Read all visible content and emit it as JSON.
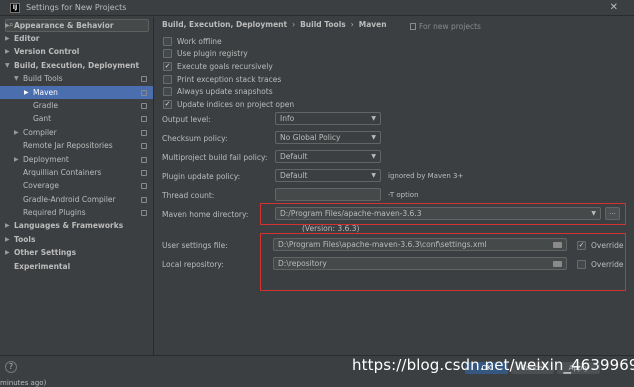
{
  "window": {
    "title": "Settings for New Projects",
    "logo": "IJ"
  },
  "search": {
    "placeholder": ""
  },
  "sidebar": {
    "items": [
      {
        "label": "Appearance & Behavior",
        "arrow": "▶",
        "bold": true
      },
      {
        "label": "Editor",
        "arrow": "▶",
        "bold": true
      },
      {
        "label": "Version Control",
        "arrow": "▶",
        "bold": true
      },
      {
        "label": "Build, Execution, Deployment",
        "arrow": "▼",
        "bold": true
      },
      {
        "label": "Build Tools",
        "arrow": "▼"
      },
      {
        "label": "Maven",
        "arrow": "▶",
        "selected": true
      },
      {
        "label": "Gradle",
        "arrow": ""
      },
      {
        "label": "Gant",
        "arrow": ""
      },
      {
        "label": "Compiler",
        "arrow": "▶"
      },
      {
        "label": "Remote Jar Repositories",
        "arrow": ""
      },
      {
        "label": "Deployment",
        "arrow": "▶"
      },
      {
        "label": "Arquillian Containers",
        "arrow": ""
      },
      {
        "label": "Coverage",
        "arrow": ""
      },
      {
        "label": "Gradle-Android Compiler",
        "arrow": ""
      },
      {
        "label": "Required Plugins",
        "arrow": ""
      },
      {
        "label": "Languages & Frameworks",
        "arrow": "▶",
        "bold": true
      },
      {
        "label": "Tools",
        "arrow": "▶",
        "bold": true
      },
      {
        "label": "Other Settings",
        "arrow": "▶",
        "bold": true
      },
      {
        "label": "Experimental",
        "arrow": "",
        "bold": true
      }
    ]
  },
  "breadcrumb": {
    "part1": "Build, Execution, Deployment",
    "part2": "Build Tools",
    "part3": "Maven",
    "sep": "›"
  },
  "for_new_projects": "For new projects",
  "checkboxes": [
    {
      "label": "Work offline",
      "checked": false
    },
    {
      "label": "Use plugin registry",
      "checked": false
    },
    {
      "label": "Execute goals recursively",
      "checked": true
    },
    {
      "label": "Print exception stack traces",
      "checked": false
    },
    {
      "label": "Always update snapshots",
      "checked": false
    },
    {
      "label": "Update indices on project open",
      "checked": true
    }
  ],
  "check_glyph": "✓",
  "fields": {
    "output_level": {
      "label": "Output level:",
      "value": "Info"
    },
    "checksum_policy": {
      "label": "Checksum policy:",
      "value": "No Global Policy"
    },
    "multiproject_fail": {
      "label": "Multiproject build fail policy:",
      "value": "Default"
    },
    "plugin_update": {
      "label": "Plugin update policy:",
      "value": "Default",
      "note": "ignored by Maven 3+"
    },
    "thread_count": {
      "label": "Thread count:",
      "value": "",
      "note": "-T option"
    },
    "maven_home": {
      "label": "Maven home directory:",
      "value": "D:/Program Files/apache-maven-3.6.3",
      "version": "(Version: 3.6.3)",
      "browse": "..."
    },
    "user_settings": {
      "label": "User settings file:",
      "value": "D:\\Program Files\\apache-maven-3.6.3\\conf\\settings.xml",
      "override_label": "Override",
      "override_checked": true
    },
    "local_repo": {
      "label": "Local repository:",
      "value": "D:\\repository",
      "override_label": "Override",
      "override_checked": false
    }
  },
  "bottom": {
    "help": "?",
    "ok": "OK",
    "cancel": "Cancel",
    "apply": "Apply",
    "taskbar_fragment": "minutes ago)"
  },
  "watermark": "https://blog.csdn.net/weixin_46399692",
  "colors": {
    "background": "#3c3f41",
    "selection": "#4b6eaf",
    "highlight_box": "#d23232",
    "text": "#bbbbbb"
  }
}
